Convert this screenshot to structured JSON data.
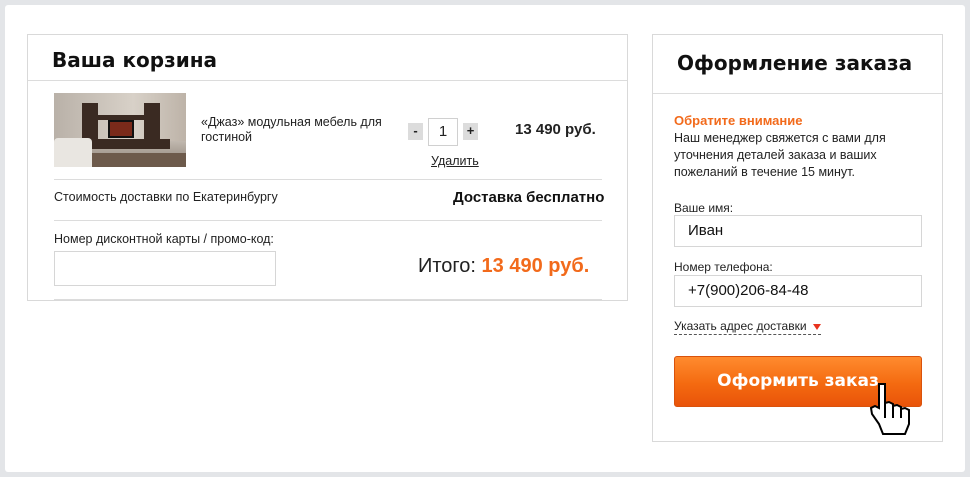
{
  "cart": {
    "title": "Ваша корзина",
    "item": {
      "name": "«Джаз» модульная мебель для гостиной",
      "minus_label": "-",
      "quantity": "1",
      "plus_label": "+",
      "price": "13 490 руб.",
      "remove_label": "Удалить"
    },
    "delivery_label": "Стоимость доставки по Екатеринбургу",
    "delivery_value": "Доставка бесплатно",
    "promo_label": "Номер дисконтной карты / промо-код:",
    "promo_value": "",
    "total_label": "Итого:",
    "total_amount": "13 490 руб."
  },
  "checkout": {
    "title": "Оформление заказа",
    "note_title": "Обратите внимание",
    "note_text": "Наш менеджер свяжется с вами для уточнения деталей заказа и ваших пожеланий в течение 15 минут.",
    "name_label": "Ваше имя:",
    "name_value": "Иван",
    "phone_label": "Номер телефона:",
    "phone_value": "+7(900)206-84-48",
    "address_toggle": "Указать адрес доставки",
    "submit_label": "Оформить заказ"
  },
  "colors": {
    "accent": "#f26a1b",
    "arrow": "#e8321e"
  }
}
